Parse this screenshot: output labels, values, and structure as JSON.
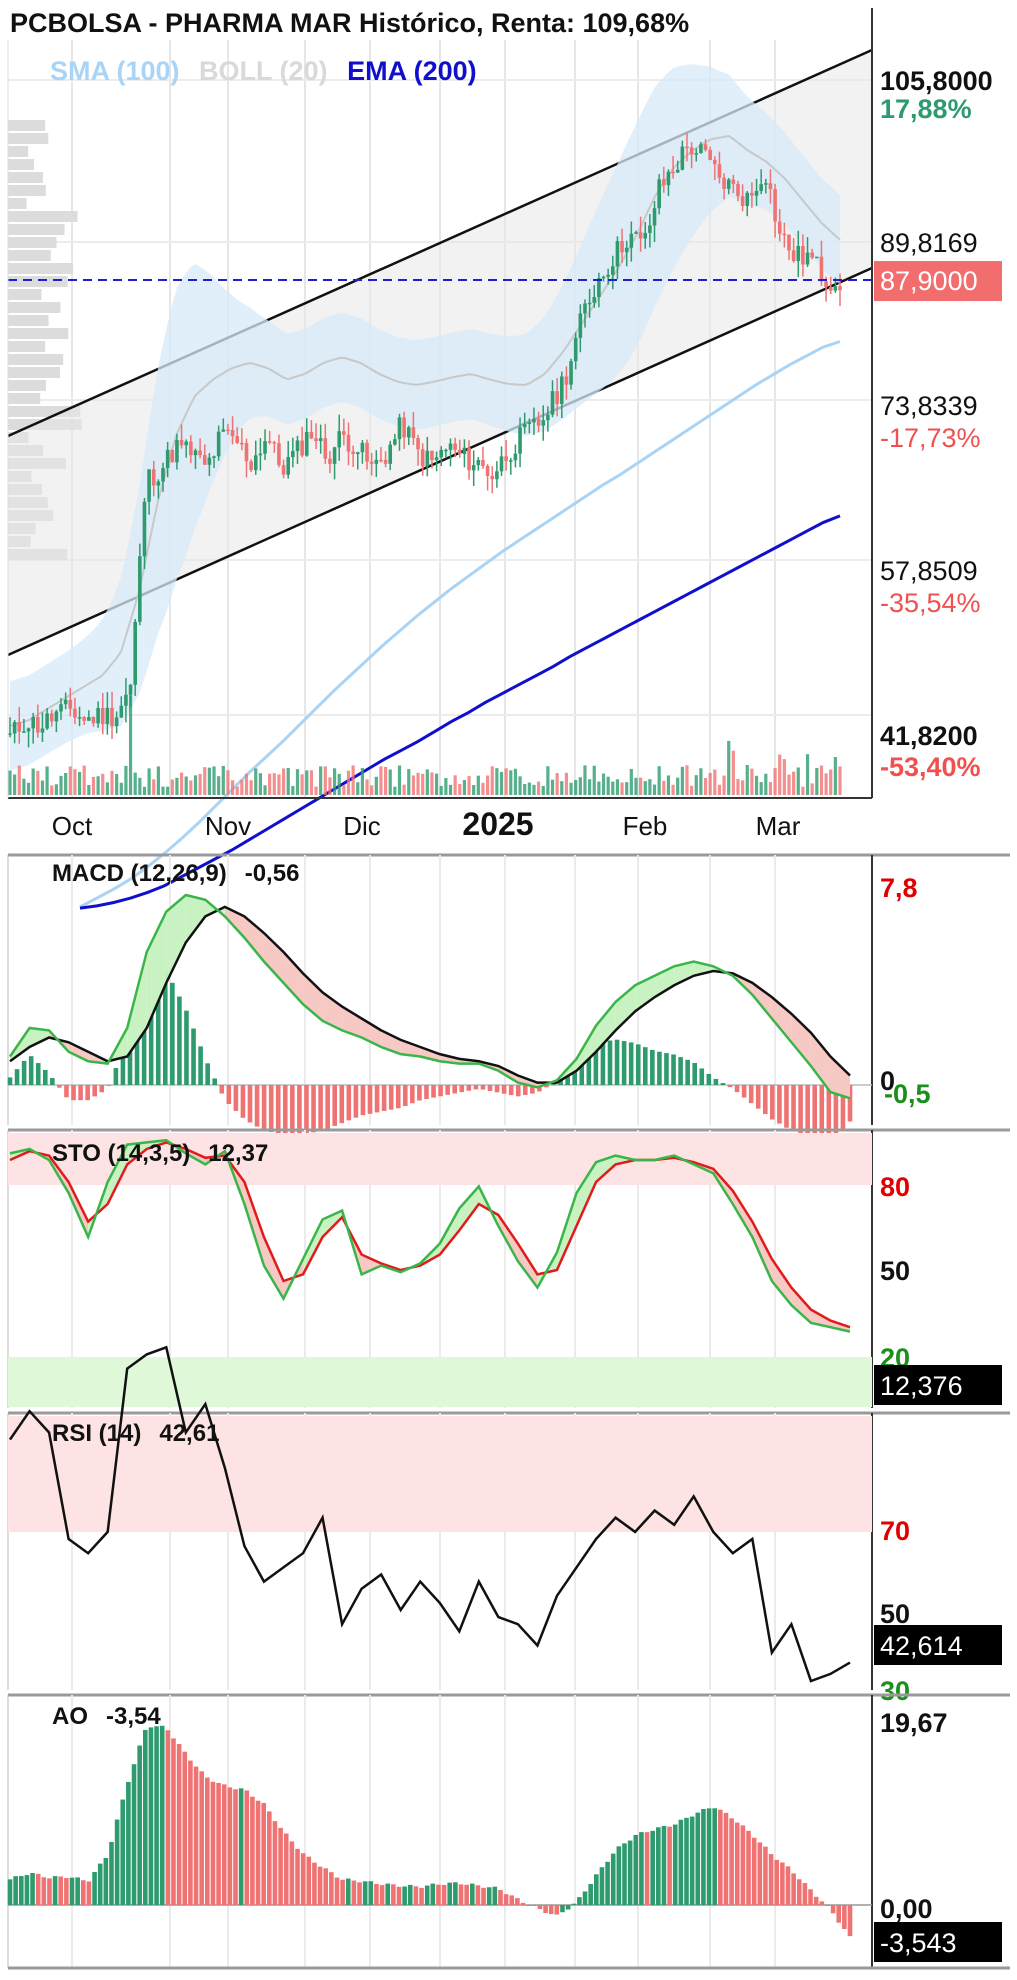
{
  "title": "PCBOLSA - PHARMA MAR Histórico, Renta: 109,68%",
  "legend": [
    {
      "label": "SMA (100)",
      "color": "#a9d4f5"
    },
    {
      "label": "BOLL (20)",
      "color": "#d9d9d9"
    },
    {
      "label": "EMA (200)",
      "color": "#1010cc"
    }
  ],
  "colors": {
    "up": "#2e9b6e",
    "down": "#f07373",
    "up_bright": "#39b54a",
    "channel": "#e8e8e8",
    "boll_fill": "#d6eaf8",
    "current": "#f26d6d"
  },
  "chart_data": [
    {
      "type": "candlestick",
      "name": "price",
      "title": "PCBOLSA - PHARMA MAR Histórico, Renta: 109,68%",
      "x_tick_labels": [
        "Oct",
        "Nov",
        "Dic",
        "2025",
        "Feb",
        "Mar"
      ],
      "price_axis": [
        {
          "value": "105,8000",
          "pct": "17,88%",
          "pct_color": "#2e9b6e"
        },
        {
          "value": "89,8169",
          "pct": "",
          "pct_color": ""
        },
        {
          "value": "73,8339",
          "pct": "-17,73%",
          "pct_color": "#f05050"
        },
        {
          "value": "57,8509",
          "pct": "-35,54%",
          "pct_color": "#f05050"
        },
        {
          "value": "41,8200",
          "pct": "-53,40%",
          "pct_color": "#f05050"
        }
      ],
      "ylim": [
        41.82,
        105.8
      ],
      "current_price": "87,9000",
      "current_price_value": 87.9,
      "series": [
        {
          "name": "SMA (100)",
          "values": [
            31.8,
            32.6,
            33.4,
            34.3,
            35.4,
            36.6,
            37.9,
            39.3,
            40.8,
            42.3,
            43.8,
            45.2,
            46.6,
            48.1,
            49.6,
            51.1,
            52.5,
            53.9,
            55.3,
            56.6,
            57.9,
            59.1,
            60.3,
            61.4,
            62.5,
            63.6,
            64.6,
            65.6,
            66.6,
            67.6,
            68.6,
            69.6,
            70.5,
            71.5,
            72.5,
            73.5,
            74.5,
            75.5,
            76.5,
            77.5,
            78.5,
            79.4,
            80.3,
            81.1,
            81.9,
            82.4
          ]
        },
        {
          "name": "EMA (200)",
          "values": [
            31.7,
            31.9,
            32.2,
            32.6,
            33.1,
            33.7,
            34.5,
            35.3,
            36.1,
            36.9,
            37.8,
            38.7,
            39.6,
            40.5,
            41.4,
            42.3,
            43.2,
            44.1,
            45.0,
            45.8,
            46.6,
            47.5,
            48.4,
            49.2,
            50.1,
            50.9,
            51.7,
            52.5,
            53.3,
            54.2,
            55.0,
            55.8,
            56.6,
            57.4,
            58.2,
            59.0,
            59.8,
            60.6,
            61.4,
            62.2,
            63.0,
            63.8,
            64.6,
            65.4,
            66.2,
            66.8
          ]
        },
        {
          "name": "BOLL (20)",
          "values": [
            48.0,
            48.5,
            49.5,
            50.5,
            51.5,
            52.5,
            54.5,
            60.0,
            68.0,
            74.0,
            77.5,
            79.0,
            80.0,
            80.5,
            80.0,
            79.0,
            79.5,
            80.5,
            81.0,
            80.5,
            79.5,
            78.8,
            78.5,
            78.8,
            79.2,
            79.5,
            79.0,
            78.6,
            78.5,
            79.5,
            81.5,
            84.0,
            86.5,
            89.0,
            92.0,
            95.5,
            98.0,
            99.5,
            100.5,
            100.8,
            99.5,
            98.5,
            97.0,
            95.0,
            93.0,
            91.5
          ]
        }
      ]
    },
    {
      "type": "line",
      "name": "MACD",
      "label": "MACD (12,26,9)",
      "value": "-0,56",
      "axis_top": "7,8",
      "axis_zero": "0",
      "axis_signal": "-0,5",
      "series": [
        {
          "name": "MACD",
          "values": [
            1.2,
            2.4,
            2.3,
            1.4,
            1.0,
            0.9,
            2.4,
            5.6,
            7.3,
            8.0,
            7.8,
            7.1,
            6.2,
            5.2,
            4.3,
            3.4,
            2.7,
            2.3,
            2.0,
            1.6,
            1.3,
            1.2,
            1.0,
            0.9,
            0.9,
            0.6,
            0.1,
            -0.1,
            0.2,
            1.1,
            2.5,
            3.5,
            4.2,
            4.6,
            5.0,
            5.2,
            5.0,
            4.6,
            3.8,
            2.8,
            1.8,
            0.8,
            -0.3,
            -0.56
          ]
        },
        {
          "name": "Signal",
          "values": [
            1.0,
            1.6,
            2.0,
            1.8,
            1.4,
            1.0,
            1.2,
            2.4,
            4.3,
            6.0,
            7.1,
            7.5,
            7.1,
            6.4,
            5.6,
            4.7,
            3.9,
            3.3,
            2.8,
            2.3,
            1.9,
            1.6,
            1.3,
            1.1,
            1.0,
            0.8,
            0.4,
            0.1,
            0.1,
            0.6,
            1.4,
            2.3,
            3.1,
            3.7,
            4.2,
            4.6,
            4.8,
            4.7,
            4.3,
            3.7,
            3.0,
            2.2,
            1.2,
            0.4
          ]
        }
      ]
    },
    {
      "type": "line",
      "name": "STO",
      "label": "STO (14,3,5)",
      "value": "12,37",
      "axis": [
        "80",
        "50",
        "20"
      ],
      "current": "12,376",
      "ylim": [
        0,
        100
      ],
      "series": [
        {
          "name": "%K",
          "values": [
            93,
            95,
            90,
            75,
            55,
            80,
            97,
            98,
            99,
            93,
            88,
            94,
            70,
            42,
            27,
            45,
            63,
            67,
            38,
            42,
            39,
            43,
            52,
            68,
            78,
            60,
            44,
            32,
            48,
            75,
            89,
            92,
            90,
            90,
            92,
            88,
            84,
            70,
            55,
            35,
            24,
            16,
            14,
            12
          ]
        },
        {
          "name": "%D",
          "values": [
            90,
            94,
            92,
            80,
            62,
            70,
            88,
            95,
            98,
            95,
            91,
            92,
            80,
            55,
            35,
            38,
            55,
            64,
            47,
            43,
            40,
            42,
            47,
            58,
            70,
            65,
            52,
            38,
            40,
            60,
            80,
            88,
            90,
            90,
            91,
            89,
            86,
            76,
            62,
            45,
            32,
            22,
            17,
            14
          ]
        }
      ]
    },
    {
      "type": "line",
      "name": "RSI",
      "label": "RSI (14)",
      "value": "42,61",
      "axis": [
        "70",
        "50",
        "30"
      ],
      "current": "42,614",
      "ylim": [
        30,
        90
      ],
      "series": [
        {
          "name": "RSI",
          "values": [
            74,
            78,
            75,
            60,
            58,
            61,
            84,
            86,
            87,
            75,
            79,
            70,
            59,
            54,
            56,
            58,
            63,
            48,
            53,
            55,
            50,
            54,
            51,
            47,
            54,
            49,
            48,
            45,
            52,
            56,
            60,
            63,
            61,
            64,
            62,
            66,
            61,
            58,
            60,
            44,
            48,
            40,
            41,
            42.6
          ]
        }
      ]
    },
    {
      "type": "bar",
      "name": "AO",
      "label": "AO",
      "value": "-3,54",
      "axis_top": "19,67",
      "axis_zero": "0,00",
      "current": "-3,543",
      "values": [
        2.8,
        3.5,
        3.0,
        3.1,
        2.6,
        5.5,
        13.2,
        19.6,
        19.4,
        16.5,
        14.0,
        13.0,
        12.6,
        11.0,
        8.0,
        5.6,
        4.1,
        2.8,
        2.6,
        2.3,
        2.1,
        2.0,
        2.3,
        2.4,
        2.1,
        1.8,
        0.6,
        -0.4,
        -1.2,
        0.3,
        3.2,
        6.0,
        7.6,
        8.3,
        8.8,
        9.9,
        10.8,
        9.5,
        7.7,
        5.5,
        3.8,
        1.6,
        -0.5,
        -3.54
      ]
    }
  ]
}
